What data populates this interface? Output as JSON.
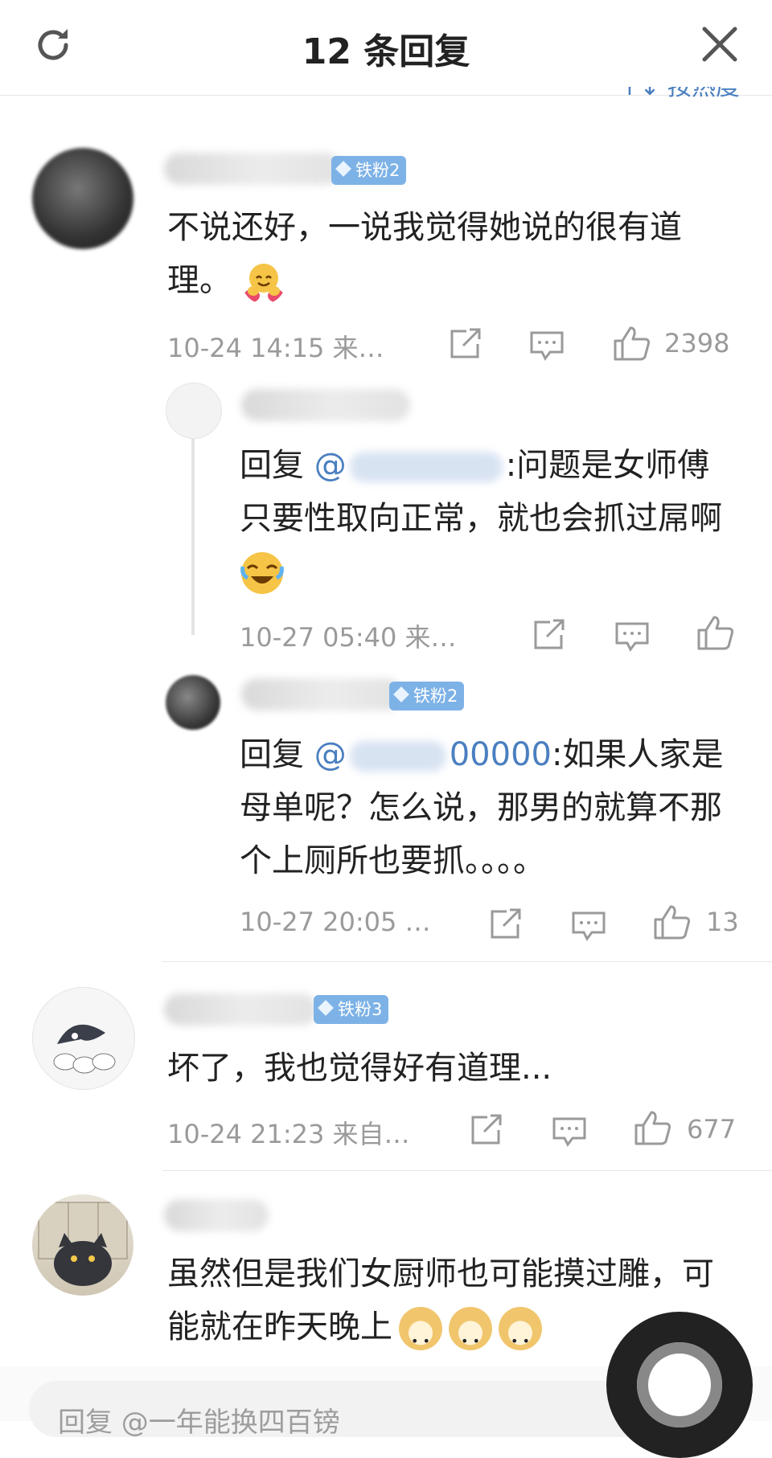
{
  "header": {
    "title": "12 条回复",
    "sort_partial": "↑↓ 按热度"
  },
  "comments": [
    {
      "badge": "铁粉2",
      "text": "不说还好，一说我觉得她说的很有道理。",
      "time": "10-24 14:15  来…",
      "likes": "2398",
      "replies": [
        {
          "prefix": "回复 ",
          "at": "@",
          "text": ":问题是女师傅只要性取向正常，就也会抓过屌啊",
          "time": "10-27 05:40  来…",
          "likes": ""
        },
        {
          "badge": "铁粉2",
          "prefix": "回复 ",
          "at": "@",
          "at_tail": "00000",
          "text": ":如果人家是母单呢？怎么说，那男的就算不那个上厕所也要抓。。。。",
          "time": "10-27 20:05  …",
          "likes": "13"
        }
      ]
    },
    {
      "badge": "铁粉3",
      "text": "坏了，我也觉得好有道理...",
      "time": "10-24 21:23  来自…",
      "likes": "677"
    },
    {
      "text": "虽然但是我们女厨师也可能摸过雕，可能就在昨天晚上"
    }
  ],
  "input": {
    "placeholder": "回复 @一年能换四百镑"
  }
}
